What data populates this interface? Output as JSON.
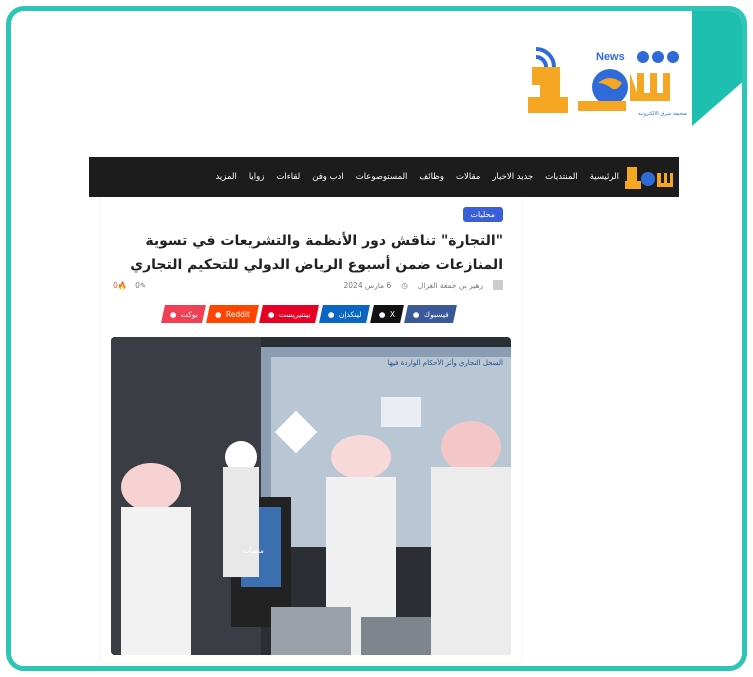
{
  "brand": {
    "logo_text": "News",
    "logo_alt": "شرق",
    "logo_subtitle": "صحيفة شرق الالكترونية"
  },
  "nav": {
    "items": [
      "الرئيسية",
      "المنتديات",
      "جديد الاخبار",
      "مقالات",
      "وظائف",
      "المستوصوعات",
      "ادب وفن",
      "لقاءات",
      "زوايا",
      "المزيد"
    ]
  },
  "article": {
    "tag": "محليات",
    "title": "\"التجارة\" تناقش دور الأنظمة والتشريعات في تسوية المنازعات ضمن أسبوع الرياض الدولي للتحكيم التجاري",
    "author": "زهير بن جمعة الغزال",
    "date": "6 مارس 2024",
    "comments": "0",
    "views": "0"
  },
  "share": [
    {
      "label": "فيسبوك",
      "icon": "facebook-icon",
      "color": "#3b5998"
    },
    {
      "label": "X",
      "icon": "x-icon",
      "color": "#111111"
    },
    {
      "label": "لينكدإن",
      "icon": "linkedin-icon",
      "color": "#0a66c2"
    },
    {
      "label": "بينتيريست",
      "icon": "pinterest-icon",
      "color": "#e60023"
    },
    {
      "label": "Reddit",
      "icon": "reddit-icon",
      "color": "#ff4500"
    },
    {
      "label": "بوكت",
      "icon": "pocket-icon",
      "color": "#ef4056"
    }
  ],
  "photo": {
    "screen_heading": "السجل التجاري وأثر الأحكام الواردة فيها",
    "podium_text": "منشآت"
  },
  "colors": {
    "frame": "#2ec4b6",
    "nav_bg": "#1c1c1c",
    "tag_bg": "#3b5fd9",
    "logo_orange": "#f5a623",
    "logo_blue": "#2f6bd8"
  }
}
